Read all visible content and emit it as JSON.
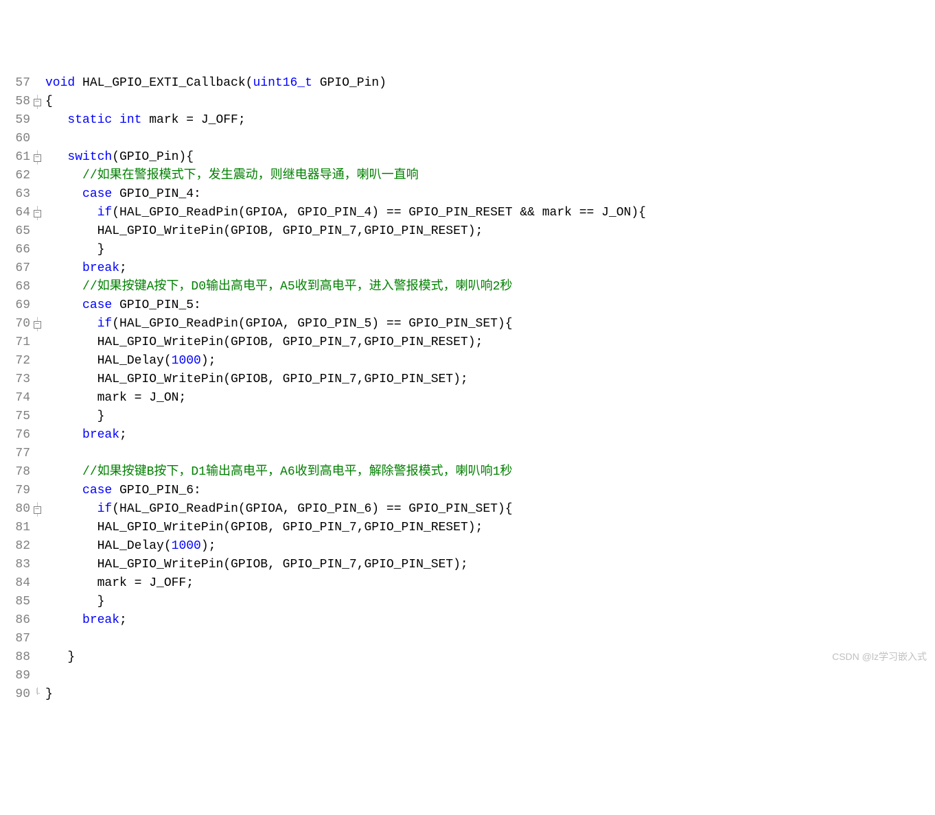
{
  "watermark": "CSDN @lz学习嵌入式",
  "lines": [
    {
      "n": "57",
      "fold": "",
      "code": [
        {
          "c": "kw",
          "t": "void"
        },
        {
          "c": "",
          "t": " HAL_GPIO_EXTI_Callback("
        },
        {
          "c": "kw",
          "t": "uint16_t"
        },
        {
          "c": "",
          "t": " GPIO_Pin)"
        }
      ]
    },
    {
      "n": "58",
      "fold": "box",
      "code": [
        {
          "c": "",
          "t": "{"
        }
      ]
    },
    {
      "n": "59",
      "fold": "line",
      "code": [
        {
          "c": "",
          "t": "   "
        },
        {
          "c": "kw",
          "t": "static"
        },
        {
          "c": "",
          "t": " "
        },
        {
          "c": "kw",
          "t": "int"
        },
        {
          "c": "",
          "t": " mark = J_OFF;"
        }
      ]
    },
    {
      "n": "60",
      "fold": "line",
      "code": [
        {
          "c": "",
          "t": ""
        }
      ]
    },
    {
      "n": "61",
      "fold": "box",
      "code": [
        {
          "c": "",
          "t": "   "
        },
        {
          "c": "kw",
          "t": "switch"
        },
        {
          "c": "",
          "t": "(GPIO_Pin){"
        }
      ]
    },
    {
      "n": "62",
      "fold": "line",
      "code": [
        {
          "c": "",
          "t": "     "
        },
        {
          "c": "comment",
          "t": "//如果在警报模式下，发生震动，则继电器导通，喇叭一直响"
        }
      ]
    },
    {
      "n": "63",
      "fold": "line",
      "code": [
        {
          "c": "",
          "t": "     "
        },
        {
          "c": "kw",
          "t": "case"
        },
        {
          "c": "",
          "t": " GPIO_PIN_4:"
        }
      ]
    },
    {
      "n": "64",
      "fold": "box",
      "code": [
        {
          "c": "",
          "t": "       "
        },
        {
          "c": "kw",
          "t": "if"
        },
        {
          "c": "",
          "t": "(HAL_GPIO_ReadPin(GPIOA, GPIO_PIN_4) == GPIO_PIN_RESET && mark == J_ON){"
        }
      ]
    },
    {
      "n": "65",
      "fold": "line",
      "code": [
        {
          "c": "",
          "t": "       HAL_GPIO_WritePin(GPIOB, GPIO_PIN_7,GPIO_PIN_RESET);"
        }
      ]
    },
    {
      "n": "66",
      "fold": "lineend",
      "code": [
        {
          "c": "",
          "t": "       }"
        }
      ]
    },
    {
      "n": "67",
      "fold": "line",
      "code": [
        {
          "c": "",
          "t": "     "
        },
        {
          "c": "kw",
          "t": "break"
        },
        {
          "c": "",
          "t": ";"
        }
      ]
    },
    {
      "n": "68",
      "fold": "line",
      "code": [
        {
          "c": "",
          "t": "     "
        },
        {
          "c": "comment",
          "t": "//如果按键A按下，D0输出高电平，A5收到高电平，进入警报模式，喇叭响2秒"
        }
      ]
    },
    {
      "n": "69",
      "fold": "line",
      "code": [
        {
          "c": "",
          "t": "     "
        },
        {
          "c": "kw",
          "t": "case"
        },
        {
          "c": "",
          "t": " GPIO_PIN_5:"
        }
      ]
    },
    {
      "n": "70",
      "fold": "box",
      "code": [
        {
          "c": "",
          "t": "       "
        },
        {
          "c": "kw",
          "t": "if"
        },
        {
          "c": "",
          "t": "(HAL_GPIO_ReadPin(GPIOA, GPIO_PIN_5) == GPIO_PIN_SET){"
        }
      ]
    },
    {
      "n": "71",
      "fold": "line",
      "code": [
        {
          "c": "",
          "t": "       HAL_GPIO_WritePin(GPIOB, GPIO_PIN_7,GPIO_PIN_RESET);"
        }
      ]
    },
    {
      "n": "72",
      "fold": "line",
      "code": [
        {
          "c": "",
          "t": "       HAL_Delay("
        },
        {
          "c": "num",
          "t": "1000"
        },
        {
          "c": "",
          "t": ");"
        }
      ]
    },
    {
      "n": "73",
      "fold": "line",
      "code": [
        {
          "c": "",
          "t": "       HAL_GPIO_WritePin(GPIOB, GPIO_PIN_7,GPIO_PIN_SET);"
        }
      ]
    },
    {
      "n": "74",
      "fold": "line",
      "code": [
        {
          "c": "",
          "t": "       mark = J_ON;"
        }
      ]
    },
    {
      "n": "75",
      "fold": "lineend",
      "code": [
        {
          "c": "",
          "t": "       }"
        }
      ]
    },
    {
      "n": "76",
      "fold": "line",
      "code": [
        {
          "c": "",
          "t": "     "
        },
        {
          "c": "kw",
          "t": "break"
        },
        {
          "c": "",
          "t": ";"
        }
      ]
    },
    {
      "n": "77",
      "fold": "line",
      "code": [
        {
          "c": "",
          "t": ""
        }
      ]
    },
    {
      "n": "78",
      "fold": "line",
      "code": [
        {
          "c": "",
          "t": "     "
        },
        {
          "c": "comment",
          "t": "//如果按键B按下，D1输出高电平，A6收到高电平，解除警报模式，喇叭响1秒"
        }
      ]
    },
    {
      "n": "79",
      "fold": "line",
      "code": [
        {
          "c": "",
          "t": "     "
        },
        {
          "c": "kw",
          "t": "case"
        },
        {
          "c": "",
          "t": " GPIO_PIN_6:"
        }
      ]
    },
    {
      "n": "80",
      "fold": "box",
      "code": [
        {
          "c": "",
          "t": "       "
        },
        {
          "c": "kw",
          "t": "if"
        },
        {
          "c": "",
          "t": "(HAL_GPIO_ReadPin(GPIOA, GPIO_PIN_6) == GPIO_PIN_SET){"
        }
      ]
    },
    {
      "n": "81",
      "fold": "line",
      "code": [
        {
          "c": "",
          "t": "       HAL_GPIO_WritePin(GPIOB, GPIO_PIN_7,GPIO_PIN_RESET);"
        }
      ]
    },
    {
      "n": "82",
      "fold": "line",
      "code": [
        {
          "c": "",
          "t": "       HAL_Delay("
        },
        {
          "c": "num",
          "t": "1000"
        },
        {
          "c": "",
          "t": ");"
        }
      ]
    },
    {
      "n": "83",
      "fold": "line",
      "code": [
        {
          "c": "",
          "t": "       HAL_GPIO_WritePin(GPIOB, GPIO_PIN_7,GPIO_PIN_SET);"
        }
      ]
    },
    {
      "n": "84",
      "fold": "line",
      "code": [
        {
          "c": "",
          "t": "       mark = J_OFF;"
        }
      ]
    },
    {
      "n": "85",
      "fold": "lineend",
      "code": [
        {
          "c": "",
          "t": "       }"
        }
      ]
    },
    {
      "n": "86",
      "fold": "line",
      "code": [
        {
          "c": "",
          "t": "     "
        },
        {
          "c": "kw",
          "t": "break"
        },
        {
          "c": "",
          "t": ";"
        }
      ]
    },
    {
      "n": "87",
      "fold": "line",
      "code": [
        {
          "c": "",
          "t": ""
        }
      ]
    },
    {
      "n": "88",
      "fold": "lineend",
      "code": [
        {
          "c": "",
          "t": "   }"
        }
      ]
    },
    {
      "n": "89",
      "fold": "line",
      "code": [
        {
          "c": "",
          "t": ""
        }
      ]
    },
    {
      "n": "90",
      "fold": "end",
      "code": [
        {
          "c": "",
          "t": "}"
        }
      ]
    }
  ]
}
